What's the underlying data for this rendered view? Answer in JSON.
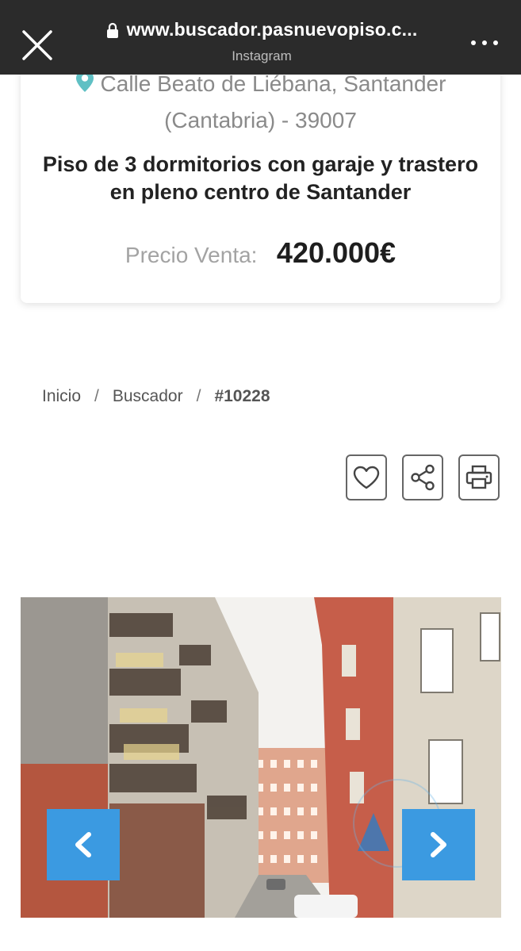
{
  "browser": {
    "url": "www.buscador.pasnuevopiso.c...",
    "source_app": "Instagram"
  },
  "listing": {
    "address_line1": "Calle Beato de Liébana, Santander",
    "address_line2": "(Cantabria) - 39007",
    "title": "Piso de 3 dormitorios con garaje y trastero en pleno centro de Santander",
    "price_label": "Precio Venta:",
    "price_value": "420.000€"
  },
  "breadcrumb": {
    "items": [
      "Inicio",
      "Buscador"
    ],
    "current": "#10228",
    "separator": "/"
  },
  "actions": [
    "heart-icon",
    "share-icon",
    "printer-icon"
  ],
  "colors": {
    "topbar": "#2b2b2b",
    "pin": "#5fc0c4",
    "nav_button": "#3b9ae1"
  }
}
